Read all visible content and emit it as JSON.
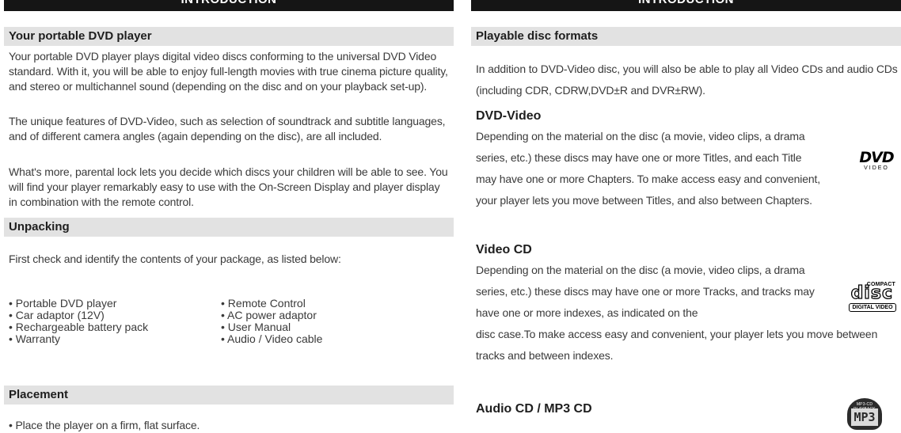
{
  "left": {
    "banner": "INTRODUCTION",
    "s1": {
      "title": "Your portable DVD player",
      "p1": "Your portable DVD player plays digital video discs conforming to the universal DVD Video standard. With it, you will be able to enjoy full-length movies with true cinema picture quality, and stereo or multichannel sound (depending on the disc and on your playback set-up).",
      "p2": "The unique features of DVD-Video, such as selection of soundtrack and subtitle languages, and of different camera angles (again depending on the disc), are all included.",
      "p3": "What's more, parental lock lets you decide which discs your children will be able to see. You will find your player remarkably easy to use with the On-Screen Display and player display in combination with the remote control."
    },
    "s2": {
      "title": "Unpacking",
      "intro": "First check and identify the contents of your package, as listed below:",
      "items": [
        "• Portable DVD player",
        "• Remote Control",
        "• Car adaptor (12V)",
        "• AC power adaptor",
        "• Rechargeable battery pack",
        "• User Manual",
        "• Warranty",
        "• Audio / Video cable"
      ]
    },
    "s3": {
      "title": "Placement",
      "b1": "• Place the player on a firm, flat surface."
    }
  },
  "right": {
    "banner": "INTRODUCTION",
    "s1": {
      "title": "Playable disc formats",
      "p1": "In addition to DVD-Video disc, you will also be able to play all  Video CDs and audio CDs (including CDR, CDRW,DVD±R and DVR±RW)."
    },
    "dvd": {
      "title": "DVD-Video",
      "p": "Depending on the material on the disc (a movie, video clips, a drama series, etc.) these discs may have one or more Titles, and each Title may have one or more Chapters. To make access easy and convenient, your player lets you move between Titles, and also between Chapters.",
      "logo_big": "DVD",
      "logo_small": "VIDEO"
    },
    "vcd": {
      "title": "Video CD",
      "p1": "Depending on the material on the disc (a movie, video clips, a drama series, etc.) these discs may have one or more Tracks, and tracks may have one or more indexes, as indicated on the",
      "p2": "disc case.To make access easy and convenient,  your player lets you move between tracks and between indexes.",
      "logo_top": "COMPACT",
      "logo_mid": "disc",
      "logo_bot": "DIGITAL VIDEO"
    },
    "acd": {
      "title": "Audio CD / MP3  CD",
      "logo_top": "MP3-CD PLAYBACK",
      "logo_mid": "MP3"
    }
  }
}
